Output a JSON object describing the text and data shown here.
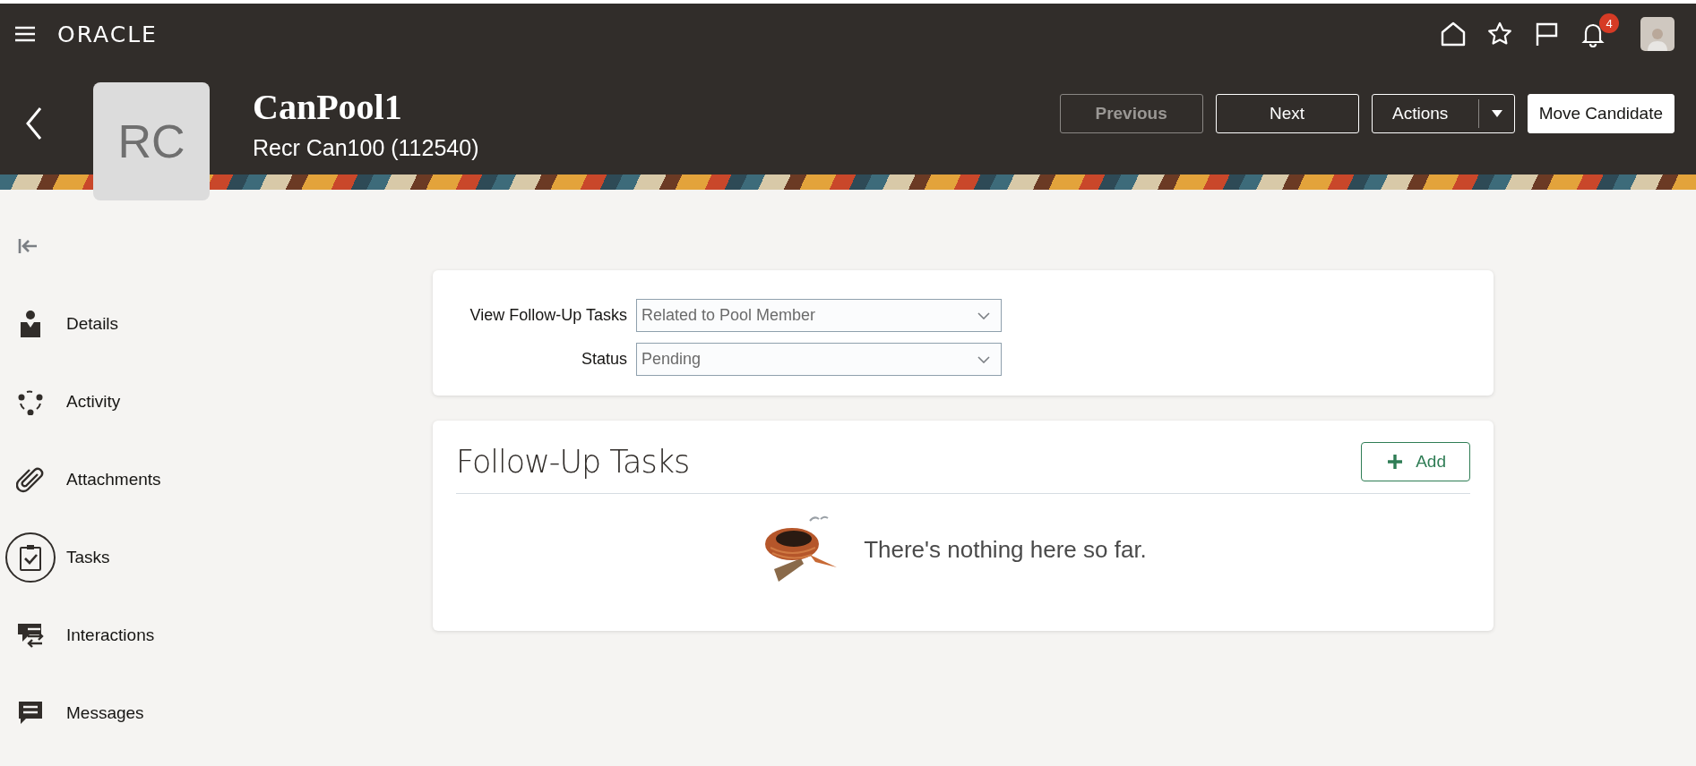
{
  "header": {
    "brand": "ORACLE",
    "notifications_count": "4",
    "title": "CanPool1",
    "subtitle": "Recr Can100 (112540)",
    "initials": "RC"
  },
  "actions": [
    {
      "label": "Previous",
      "kind": "button",
      "disabled": true
    },
    {
      "label": "Next",
      "kind": "button",
      "disabled": false
    },
    {
      "label": "Actions",
      "kind": "split",
      "disabled": false
    },
    {
      "label": "Move Candidate",
      "kind": "primary",
      "disabled": false
    }
  ],
  "sidebar": {
    "items": [
      {
        "label": "Details",
        "selected": false
      },
      {
        "label": "Activity",
        "selected": false
      },
      {
        "label": "Attachments",
        "selected": false
      },
      {
        "label": "Tasks",
        "selected": true
      },
      {
        "label": "Interactions",
        "selected": false
      },
      {
        "label": "Messages",
        "selected": false
      }
    ]
  },
  "filters": [
    {
      "label": "View Follow-Up Tasks",
      "value": "Related to Pool Member"
    },
    {
      "label": "Status",
      "value": "Pending"
    }
  ],
  "tasks_panel": {
    "title": "Follow-Up Tasks",
    "add_button": "Add",
    "empty_message": "There's nothing here so far."
  }
}
